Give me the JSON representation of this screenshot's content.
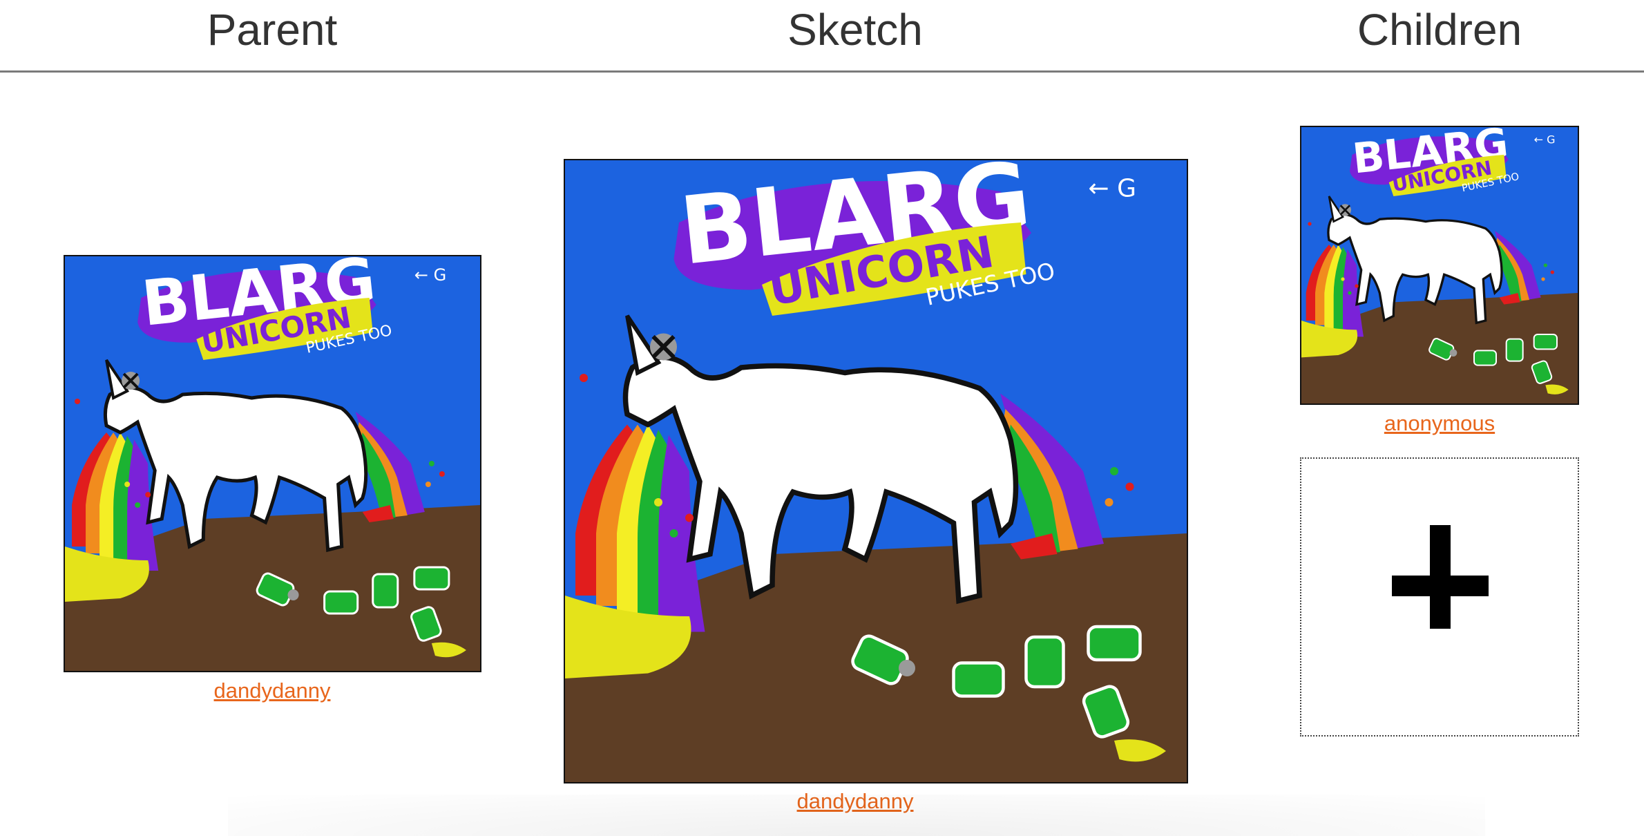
{
  "header": {
    "parent_title": "Parent",
    "sketch_title": "Sketch",
    "children_title": "Children"
  },
  "parent": {
    "author": "dandydanny"
  },
  "sketch": {
    "author": "dandydanny"
  },
  "children": {
    "items": [
      {
        "author": "anonymous"
      }
    ],
    "add_icon": "plus-icon"
  },
  "drawing": {
    "lettering": [
      "BLARG",
      "UNICORN",
      "PUKES TOO",
      "G"
    ]
  },
  "colors": {
    "link": "#e8661c",
    "header_text": "#333333",
    "divider": "#7a7a7a",
    "sky": "#1c63e0",
    "ground": "#5e3e25",
    "title_purple": "#7a22d8",
    "title_yellow": "#e4e31a"
  }
}
